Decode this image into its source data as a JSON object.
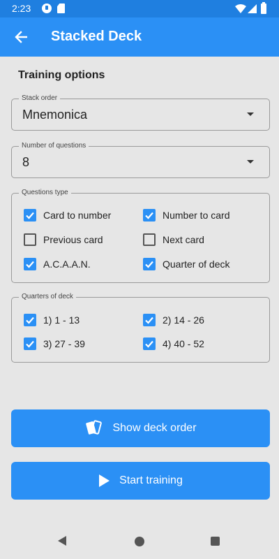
{
  "status_bar": {
    "time": "2:23"
  },
  "app_bar": {
    "title": "Stacked Deck"
  },
  "training_options_title": "Training options",
  "stack_order": {
    "label": "Stack order",
    "value": "Mnemonica"
  },
  "number_of_questions": {
    "label": "Number of questions",
    "value": "8"
  },
  "questions_type": {
    "label": "Questions type",
    "items": [
      {
        "label": "Card to number",
        "checked": true
      },
      {
        "label": "Number to card",
        "checked": true
      },
      {
        "label": "Previous card",
        "checked": false
      },
      {
        "label": "Next card",
        "checked": false
      },
      {
        "label": "A.C.A.A.N.",
        "checked": true
      },
      {
        "label": "Quarter of deck",
        "checked": true
      }
    ]
  },
  "quarters_of_deck": {
    "label": "Quarters of deck",
    "items": [
      {
        "label": "1) 1 - 13",
        "checked": true
      },
      {
        "label": "2) 14 - 26",
        "checked": true
      },
      {
        "label": "3) 27 - 39",
        "checked": true
      },
      {
        "label": "4) 40 - 52",
        "checked": true
      }
    ]
  },
  "buttons": {
    "show_deck_order": "Show deck order",
    "start_training": "Start training"
  },
  "colors": {
    "accent": "#2b90f5",
    "status_bar": "#1f7fe0",
    "background": "#e6e6e6"
  },
  "icons": [
    "back-arrow-icon",
    "dropdown-arrow-icon",
    "checkbox-icon",
    "cards-icon",
    "play-icon"
  ]
}
